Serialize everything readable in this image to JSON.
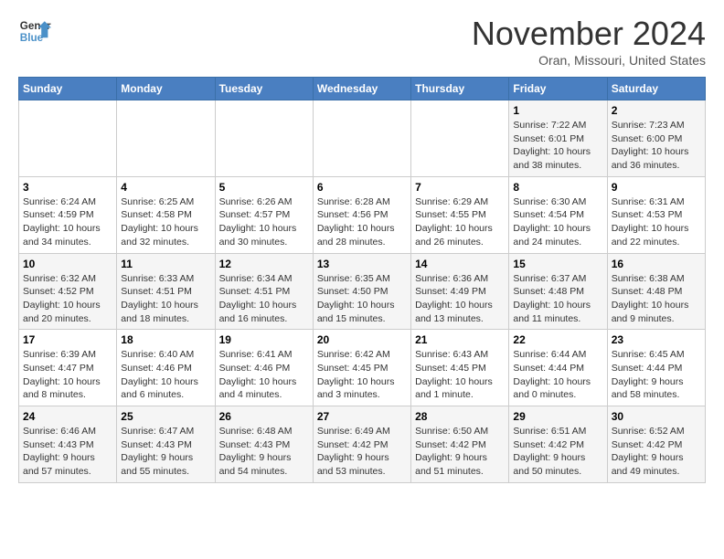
{
  "header": {
    "logo_line1": "General",
    "logo_line2": "Blue",
    "month_title": "November 2024",
    "subtitle": "Oran, Missouri, United States"
  },
  "weekdays": [
    "Sunday",
    "Monday",
    "Tuesday",
    "Wednesday",
    "Thursday",
    "Friday",
    "Saturday"
  ],
  "weeks": [
    [
      {
        "day": "",
        "info": ""
      },
      {
        "day": "",
        "info": ""
      },
      {
        "day": "",
        "info": ""
      },
      {
        "day": "",
        "info": ""
      },
      {
        "day": "",
        "info": ""
      },
      {
        "day": "1",
        "info": "Sunrise: 7:22 AM\nSunset: 6:01 PM\nDaylight: 10 hours\nand 38 minutes."
      },
      {
        "day": "2",
        "info": "Sunrise: 7:23 AM\nSunset: 6:00 PM\nDaylight: 10 hours\nand 36 minutes."
      }
    ],
    [
      {
        "day": "3",
        "info": "Sunrise: 6:24 AM\nSunset: 4:59 PM\nDaylight: 10 hours\nand 34 minutes."
      },
      {
        "day": "4",
        "info": "Sunrise: 6:25 AM\nSunset: 4:58 PM\nDaylight: 10 hours\nand 32 minutes."
      },
      {
        "day": "5",
        "info": "Sunrise: 6:26 AM\nSunset: 4:57 PM\nDaylight: 10 hours\nand 30 minutes."
      },
      {
        "day": "6",
        "info": "Sunrise: 6:28 AM\nSunset: 4:56 PM\nDaylight: 10 hours\nand 28 minutes."
      },
      {
        "day": "7",
        "info": "Sunrise: 6:29 AM\nSunset: 4:55 PM\nDaylight: 10 hours\nand 26 minutes."
      },
      {
        "day": "8",
        "info": "Sunrise: 6:30 AM\nSunset: 4:54 PM\nDaylight: 10 hours\nand 24 minutes."
      },
      {
        "day": "9",
        "info": "Sunrise: 6:31 AM\nSunset: 4:53 PM\nDaylight: 10 hours\nand 22 minutes."
      }
    ],
    [
      {
        "day": "10",
        "info": "Sunrise: 6:32 AM\nSunset: 4:52 PM\nDaylight: 10 hours\nand 20 minutes."
      },
      {
        "day": "11",
        "info": "Sunrise: 6:33 AM\nSunset: 4:51 PM\nDaylight: 10 hours\nand 18 minutes."
      },
      {
        "day": "12",
        "info": "Sunrise: 6:34 AM\nSunset: 4:51 PM\nDaylight: 10 hours\nand 16 minutes."
      },
      {
        "day": "13",
        "info": "Sunrise: 6:35 AM\nSunset: 4:50 PM\nDaylight: 10 hours\nand 15 minutes."
      },
      {
        "day": "14",
        "info": "Sunrise: 6:36 AM\nSunset: 4:49 PM\nDaylight: 10 hours\nand 13 minutes."
      },
      {
        "day": "15",
        "info": "Sunrise: 6:37 AM\nSunset: 4:48 PM\nDaylight: 10 hours\nand 11 minutes."
      },
      {
        "day": "16",
        "info": "Sunrise: 6:38 AM\nSunset: 4:48 PM\nDaylight: 10 hours\nand 9 minutes."
      }
    ],
    [
      {
        "day": "17",
        "info": "Sunrise: 6:39 AM\nSunset: 4:47 PM\nDaylight: 10 hours\nand 8 minutes."
      },
      {
        "day": "18",
        "info": "Sunrise: 6:40 AM\nSunset: 4:46 PM\nDaylight: 10 hours\nand 6 minutes."
      },
      {
        "day": "19",
        "info": "Sunrise: 6:41 AM\nSunset: 4:46 PM\nDaylight: 10 hours\nand 4 minutes."
      },
      {
        "day": "20",
        "info": "Sunrise: 6:42 AM\nSunset: 4:45 PM\nDaylight: 10 hours\nand 3 minutes."
      },
      {
        "day": "21",
        "info": "Sunrise: 6:43 AM\nSunset: 4:45 PM\nDaylight: 10 hours\nand 1 minute."
      },
      {
        "day": "22",
        "info": "Sunrise: 6:44 AM\nSunset: 4:44 PM\nDaylight: 10 hours\nand 0 minutes."
      },
      {
        "day": "23",
        "info": "Sunrise: 6:45 AM\nSunset: 4:44 PM\nDaylight: 9 hours\nand 58 minutes."
      }
    ],
    [
      {
        "day": "24",
        "info": "Sunrise: 6:46 AM\nSunset: 4:43 PM\nDaylight: 9 hours\nand 57 minutes."
      },
      {
        "day": "25",
        "info": "Sunrise: 6:47 AM\nSunset: 4:43 PM\nDaylight: 9 hours\nand 55 minutes."
      },
      {
        "day": "26",
        "info": "Sunrise: 6:48 AM\nSunset: 4:43 PM\nDaylight: 9 hours\nand 54 minutes."
      },
      {
        "day": "27",
        "info": "Sunrise: 6:49 AM\nSunset: 4:42 PM\nDaylight: 9 hours\nand 53 minutes."
      },
      {
        "day": "28",
        "info": "Sunrise: 6:50 AM\nSunset: 4:42 PM\nDaylight: 9 hours\nand 51 minutes."
      },
      {
        "day": "29",
        "info": "Sunrise: 6:51 AM\nSunset: 4:42 PM\nDaylight: 9 hours\nand 50 minutes."
      },
      {
        "day": "30",
        "info": "Sunrise: 6:52 AM\nSunset: 4:42 PM\nDaylight: 9 hours\nand 49 minutes."
      }
    ]
  ]
}
